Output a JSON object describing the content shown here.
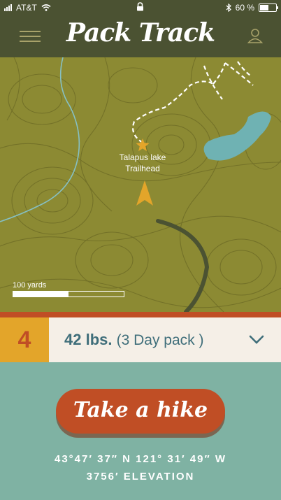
{
  "status": {
    "carrier": "AT&T",
    "battery_text": "60 %",
    "battery_level": 0.6,
    "icons": [
      "signal-icon",
      "wifi-icon",
      "lock-icon",
      "bluetooth-icon",
      "battery-icon"
    ]
  },
  "header": {
    "app_title": "Pack Track",
    "menu_icon": "hamburger-menu-icon",
    "profile_icon": "user-icon"
  },
  "map": {
    "trailhead_line1": "Talapus lake",
    "trailhead_line2": "Trailhead",
    "scale_label": "100 yards",
    "scale_fill": 0.5,
    "icons": [
      "star-icon",
      "direction-arrow-icon"
    ]
  },
  "pack": {
    "count": "4",
    "weight": "42 lbs.",
    "description": "(3 Day pack )",
    "dropdown_icon": "chevron-down-icon"
  },
  "action": {
    "button_label": "Take a hike"
  },
  "location": {
    "coordinates": "43°47′ 37″ N  121° 31′ 49″ W",
    "elevation": "3756′ ELEVATION"
  },
  "colors": {
    "header_bg": "#4b5232",
    "map_bg": "#8c8a33",
    "accent_red": "#c04e25",
    "accent_yellow": "#e3a52a",
    "footer_bg": "#7fb2a3",
    "pack_text": "#3f6e7a"
  }
}
